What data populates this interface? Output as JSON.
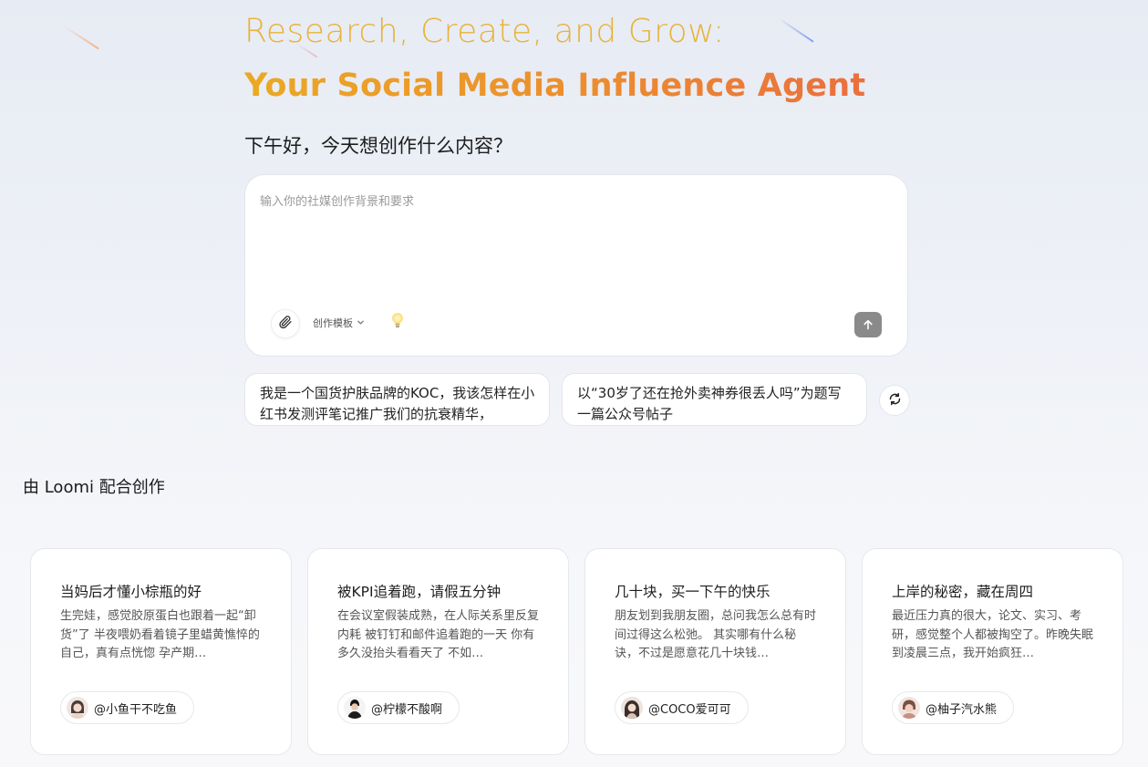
{
  "hero": {
    "line1": "Research, Create, and Grow:",
    "line2": "Your Social Media Influence Agent",
    "greeting": "下午好，今天想创作什么内容？"
  },
  "composer": {
    "placeholder": "输入你的社媒创作背景和要求",
    "value": "",
    "template_label": "创作模板",
    "icons": {
      "attach": "paperclip-icon",
      "template_toggle": "chevron-down-icon",
      "idea": "lightbulb-icon",
      "send": "arrow-up-icon"
    }
  },
  "suggestions": [
    {
      "text": "我是一个国货护肤品牌的KOC，我该怎样在小红书发测评笔记推广我们的抗衰精华，"
    },
    {
      "text": "以“30岁了还在抢外卖神券很丢人吗”为题写一篇公众号帖子"
    }
  ],
  "refresh_icon": "refresh-icon",
  "section": {
    "title": "由 Loomi 配合创作"
  },
  "cards": [
    {
      "title": "当妈后才懂小棕瓶的好",
      "body": "生完娃，感觉胶原蛋白也跟着一起“卸货”了 半夜喂奶看着镜子里蜡黄憔悴的自己，真有点恍惚 孕产期…",
      "author": "@小鱼干不吃鱼"
    },
    {
      "title": "被KPI追着跑，请假五分钟",
      "body": "在会议室假装成熟，在人际关系里反复内耗 被钉钉和邮件追着跑的一天 你有多久没抬头看看天了 不如…",
      "author": "@柠檬不酸啊"
    },
    {
      "title": "几十块，买一下午的快乐",
      "body": "朋友划到我朋友圈，总问我怎么总有时间过得这么松弛。 其实哪有什么秘诀，不过是愿意花几十块钱…",
      "author": "@COCO爱可可"
    },
    {
      "title": "上岸的秘密，藏在周四",
      "body": "最近压力真的很大，论文、实习、考研，感觉整个人都被掏空了。昨晚失眠到凌晨三点，我开始疯狂…",
      "author": "@柚子汽水熊"
    }
  ],
  "colors": {
    "hero_line1": "#e8b33a",
    "hero_gradient_start": "#eaa924",
    "hero_gradient_end": "#ea6f3e",
    "send_button": "#8a8a8a"
  }
}
